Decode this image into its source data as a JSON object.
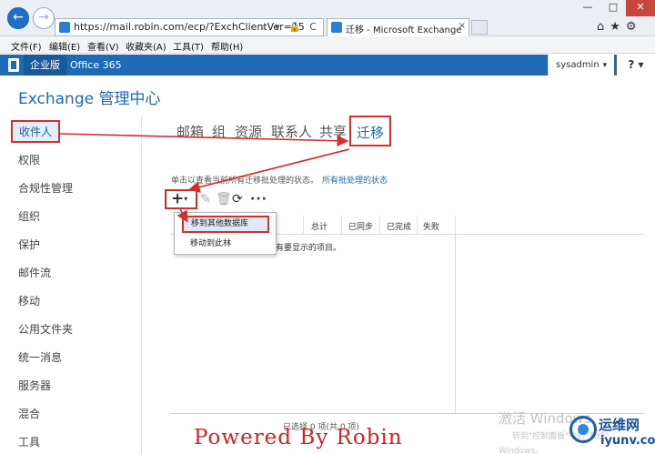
{
  "browser": {
    "url": "https://mail.robin.com/ecp/?ExchClientVer=15",
    "url_icons": "⌕ ▾ 🔒 C",
    "tab_title": "迁移 - Microsoft Exchange",
    "tab_close": "×",
    "back_glyph": "←",
    "forward_glyph": "→",
    "window_controls": {
      "minimize": "—",
      "maximize": "□",
      "close": "✕"
    },
    "tool_icons": "⌂★⚙"
  },
  "menubar": {
    "items": [
      "文件(F)",
      "编辑(E)",
      "查看(V)",
      "收藏夹(A)",
      "工具(T)",
      "帮助(H)"
    ]
  },
  "o365": {
    "enterprise_label": "企业版",
    "office_label": "Office 365",
    "user": "sysadmin",
    "user_caret": "▾",
    "help": "? ▾"
  },
  "eac": {
    "title": "Exchange 管理中心"
  },
  "leftnav": {
    "items": [
      "收件人",
      "权限",
      "合规性管理",
      "组织",
      "保护",
      "邮件流",
      "移动",
      "公用文件夹",
      "统一消息",
      "服务器",
      "混合",
      "工具"
    ],
    "active_index": 0
  },
  "tabs": {
    "items": [
      "邮箱",
      "组",
      "资源",
      "联系人",
      "共享",
      "迁移"
    ],
    "active_index": 5
  },
  "main": {
    "hint": "单击以查看当前所有迁移批处理的状态。",
    "hint_link": "所有批处理的状态",
    "toolbar": {
      "add": "+",
      "add_caret": "▾",
      "edit": "✎",
      "delete": "🗑",
      "refresh": "⟳",
      "more": "···"
    },
    "columns": [
      "总计",
      "已同步",
      "已完成",
      "失败"
    ],
    "empty_message": "中没有要显示的项目。",
    "status": "已选择 0 项(共 0 项)"
  },
  "dropdown": {
    "items": [
      "移到其他数据库",
      "移动到此林"
    ]
  },
  "annotations": {
    "watermark": "Powered By Robin",
    "activate_title": "激活 Windows",
    "activate_sub": "转到\"控制面板\"中的\"系统\"",
    "activate_sub2": "Windows。",
    "site_cn": "运维网",
    "site_en": "iyunv.com",
    "arrow_color": "#d62d2d"
  }
}
